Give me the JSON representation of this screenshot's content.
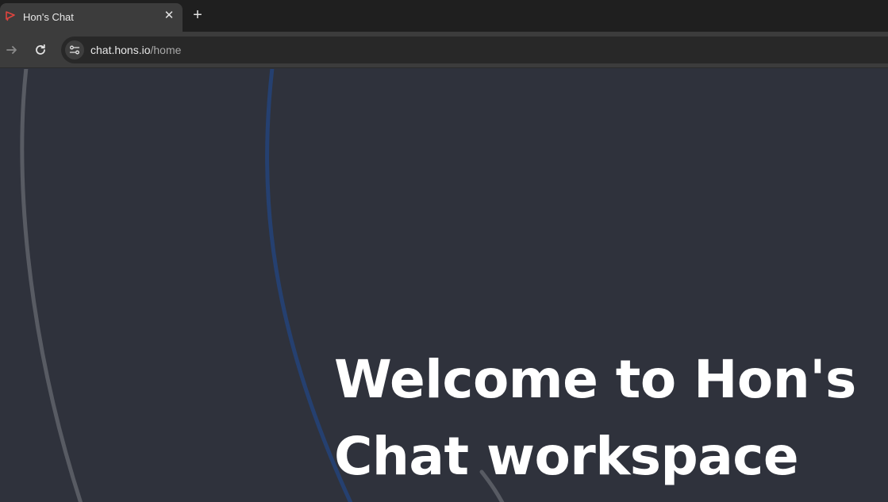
{
  "browser": {
    "tab": {
      "title": "Hon's Chat",
      "favicon": "chat-logo-icon",
      "close_icon": "close-icon"
    },
    "new_tab_icon": "plus-icon",
    "toolbar": {
      "forward_icon": "arrow-right-icon",
      "reload_icon": "reload-icon",
      "site_info_icon": "site-settings-icon"
    },
    "address": {
      "host": "chat.hons.io",
      "path": "/home"
    }
  },
  "page": {
    "headline_line1": "Welcome to Hon's",
    "headline_line2": "Chat workspace"
  },
  "colors": {
    "background": "#2f323c",
    "arc_grey": "#585b63",
    "arc_blue": "#254070",
    "favicon": "#e0443e"
  }
}
